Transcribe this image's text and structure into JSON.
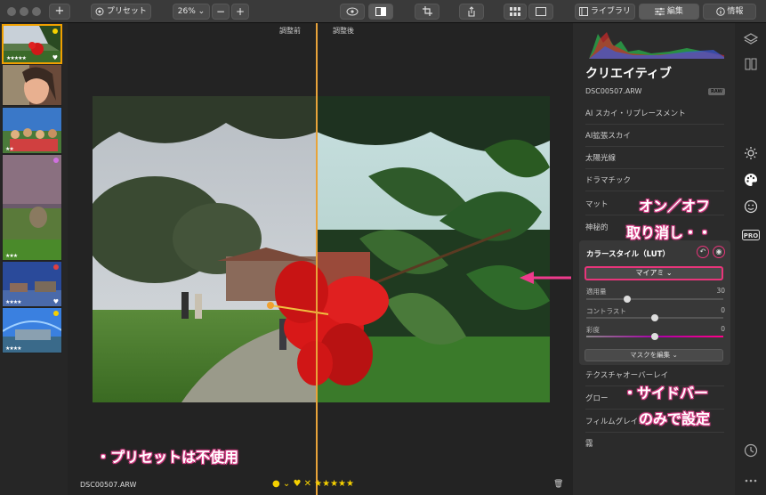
{
  "toolbar": {
    "add_label": "+",
    "preset_label": "プリセット",
    "zoom_value": "26%",
    "zoom_chevron": "⌄",
    "zoom_minus": "−",
    "zoom_plus": "+",
    "library_label": "ライブラリ",
    "edit_label": "編集",
    "info_label": "情報"
  },
  "filmstrip": {
    "thumbs": [
      {
        "stars": "★★★★★",
        "dot_color": "#f5d000",
        "heart": "♥"
      },
      {
        "stars": "",
        "dot_color": "",
        "heart": ""
      },
      {
        "stars": "★★",
        "dot_color": "",
        "heart": ""
      },
      {
        "stars": "★★★",
        "dot_color": "#d070e0",
        "heart": ""
      },
      {
        "stars": "★★★★",
        "dot_color": "#e04040",
        "heart": "♥"
      },
      {
        "stars": "★★★★",
        "dot_color": "#f5d000",
        "heart": ""
      }
    ]
  },
  "main": {
    "before_label": "調整前",
    "after_label": "調整後",
    "filename": "DSC00507.ARW",
    "bottom_controls": "● ⌄   ♥   ✕ ★★★★★",
    "trash_icon": "🗑"
  },
  "sidebar": {
    "title": "クリエイティブ",
    "file": "DSC00507.ARW",
    "raw_badge": "RAW",
    "items_top": [
      "AI スカイ・リプレースメント",
      "AI拡張スカイ",
      "太陽光線",
      "ドラマチック",
      "マット",
      "神秘的"
    ],
    "lut": {
      "title": "カラースタイル（LUT）",
      "undo_icon": "↶",
      "toggle_icon": "◉",
      "selected": "マイアミ ⌄",
      "sliders": [
        {
          "label": "適用量",
          "value": "30",
          "pos": 0.3
        },
        {
          "label": "コントラスト",
          "value": "0",
          "pos": 0.5
        },
        {
          "label": "彩度",
          "value": "0",
          "pos": 0.5
        }
      ],
      "mask_button": "マスクを編集 ⌄"
    },
    "items_bottom": [
      "テクスチャオーバーレイ",
      "グロー",
      "フィルムグレイン",
      "霧"
    ]
  },
  "annotations": {
    "toggle_note": "オン／オフ",
    "undo_note": "取り消し・・",
    "sidebar_note_1": "・サイドバー",
    "sidebar_note_2": "のみで設定",
    "preset_note": "・プリセットは不使用"
  },
  "colors": {
    "accent": "#e8357a",
    "selection": "#f0a000",
    "split_line": "#e8a33a"
  }
}
